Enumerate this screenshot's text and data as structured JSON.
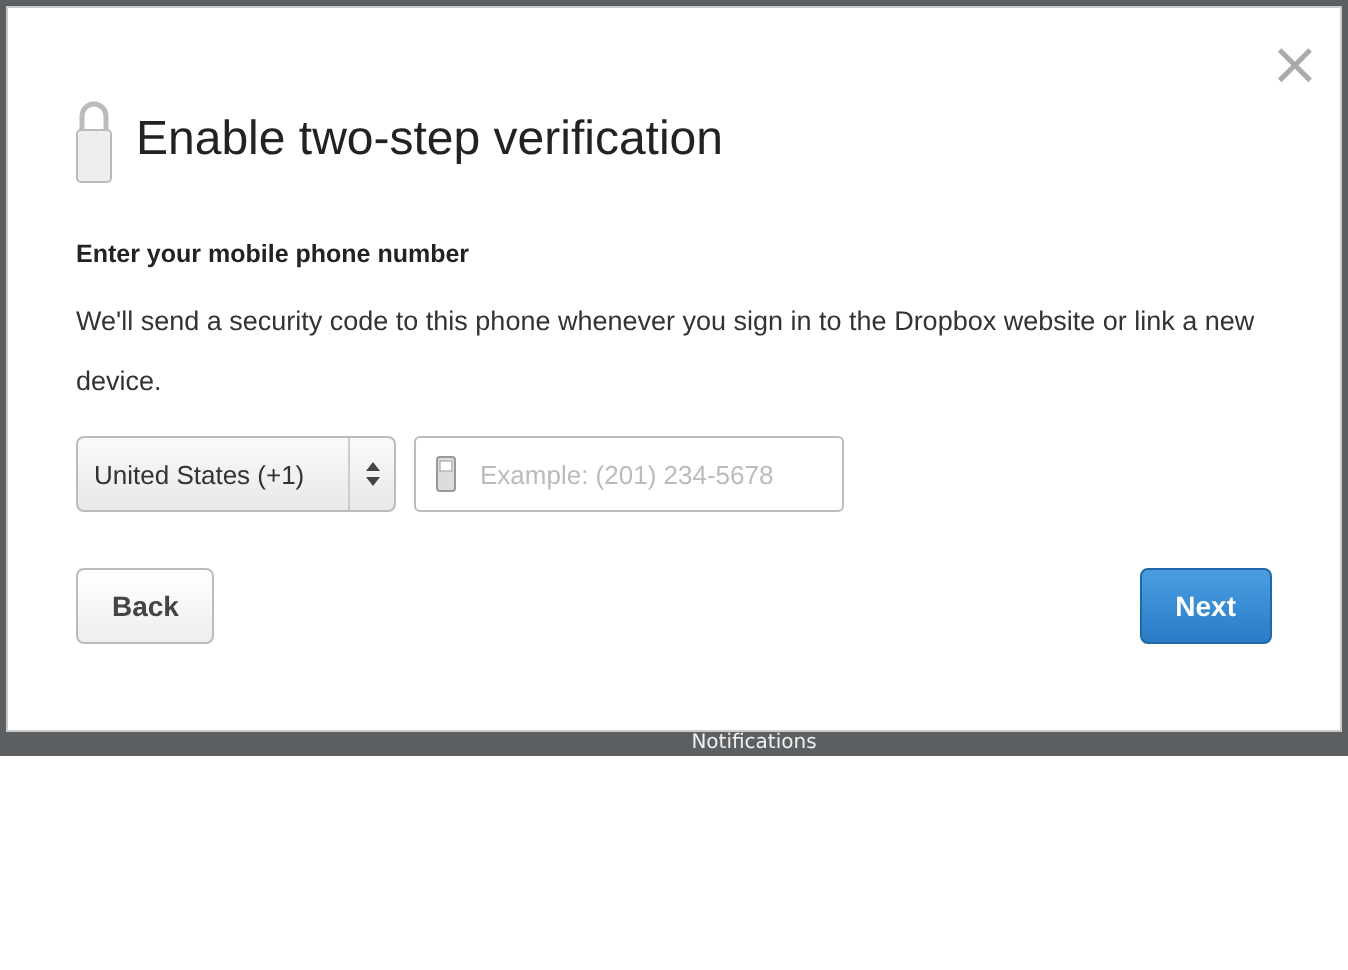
{
  "dialog": {
    "title": "Enable two-step verification",
    "close": "×",
    "heading": "Enter your mobile phone number",
    "description": "We'll send a security code to this phone whenever you sign in to the Dropbox website or link a new device.",
    "country": {
      "value": "United States (+1)"
    },
    "phone": {
      "placeholder": "Example: (201) 234-5678"
    },
    "buttons": [
      {
        "label": "Back",
        "kind": "secondary"
      },
      {
        "label": "Next",
        "kind": "primary"
      }
    ]
  },
  "background": {
    "label": "Notifications"
  }
}
